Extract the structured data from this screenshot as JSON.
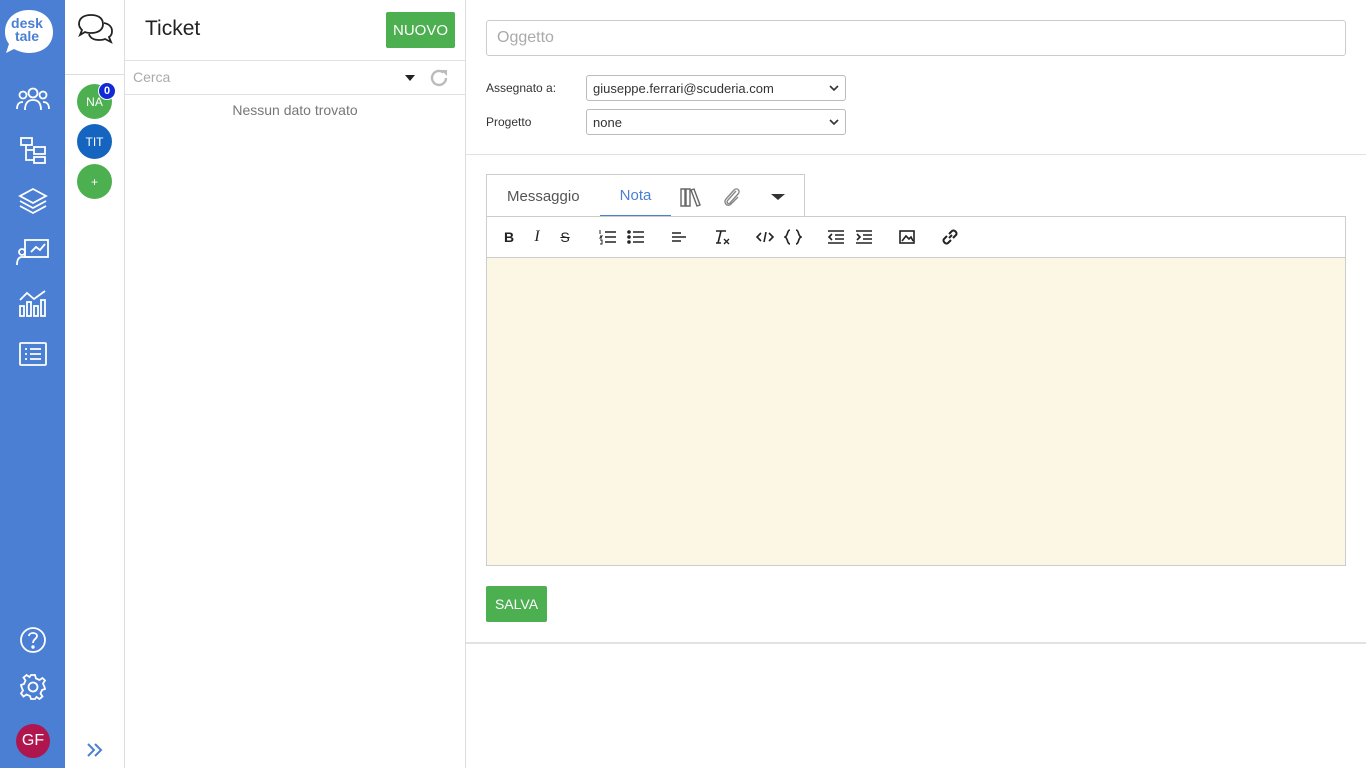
{
  "rail": {
    "logo_line1": "desk",
    "logo_line2": "tale",
    "items": [
      {
        "icon": "users-icon"
      },
      {
        "icon": "hierarchy-icon"
      },
      {
        "icon": "layers-icon"
      },
      {
        "icon": "presentation-icon"
      },
      {
        "icon": "analytics-icon"
      },
      {
        "icon": "list-icon"
      }
    ],
    "help_icon": "help-icon",
    "settings_icon": "gear-icon",
    "user_initials": "GF"
  },
  "channels": {
    "items": [
      {
        "label": "NA",
        "color": "#4caf50"
      },
      {
        "label": "TIT",
        "color": "#1565c0"
      },
      {
        "label": "+",
        "color": "#4caf50"
      }
    ],
    "badge_count": "0"
  },
  "ticket_list": {
    "title": "Ticket",
    "new_button": "NUOVO",
    "search_placeholder": "Cerca",
    "empty_text": "Nessun dato trovato"
  },
  "form": {
    "subject_placeholder": "Oggetto",
    "assigned_label": "Assegnato a:",
    "assigned_value": "giuseppe.ferrari@scuderia.com",
    "project_label": "Progetto",
    "project_value": "none",
    "tabs": {
      "message": "Messaggio",
      "note": "Nota"
    },
    "save_button": "SALVA"
  },
  "colors": {
    "brand_blue": "#4a7fd4",
    "green": "#4caf50",
    "editor_bg": "#fcf7e4",
    "avatar": "#b0164e"
  }
}
